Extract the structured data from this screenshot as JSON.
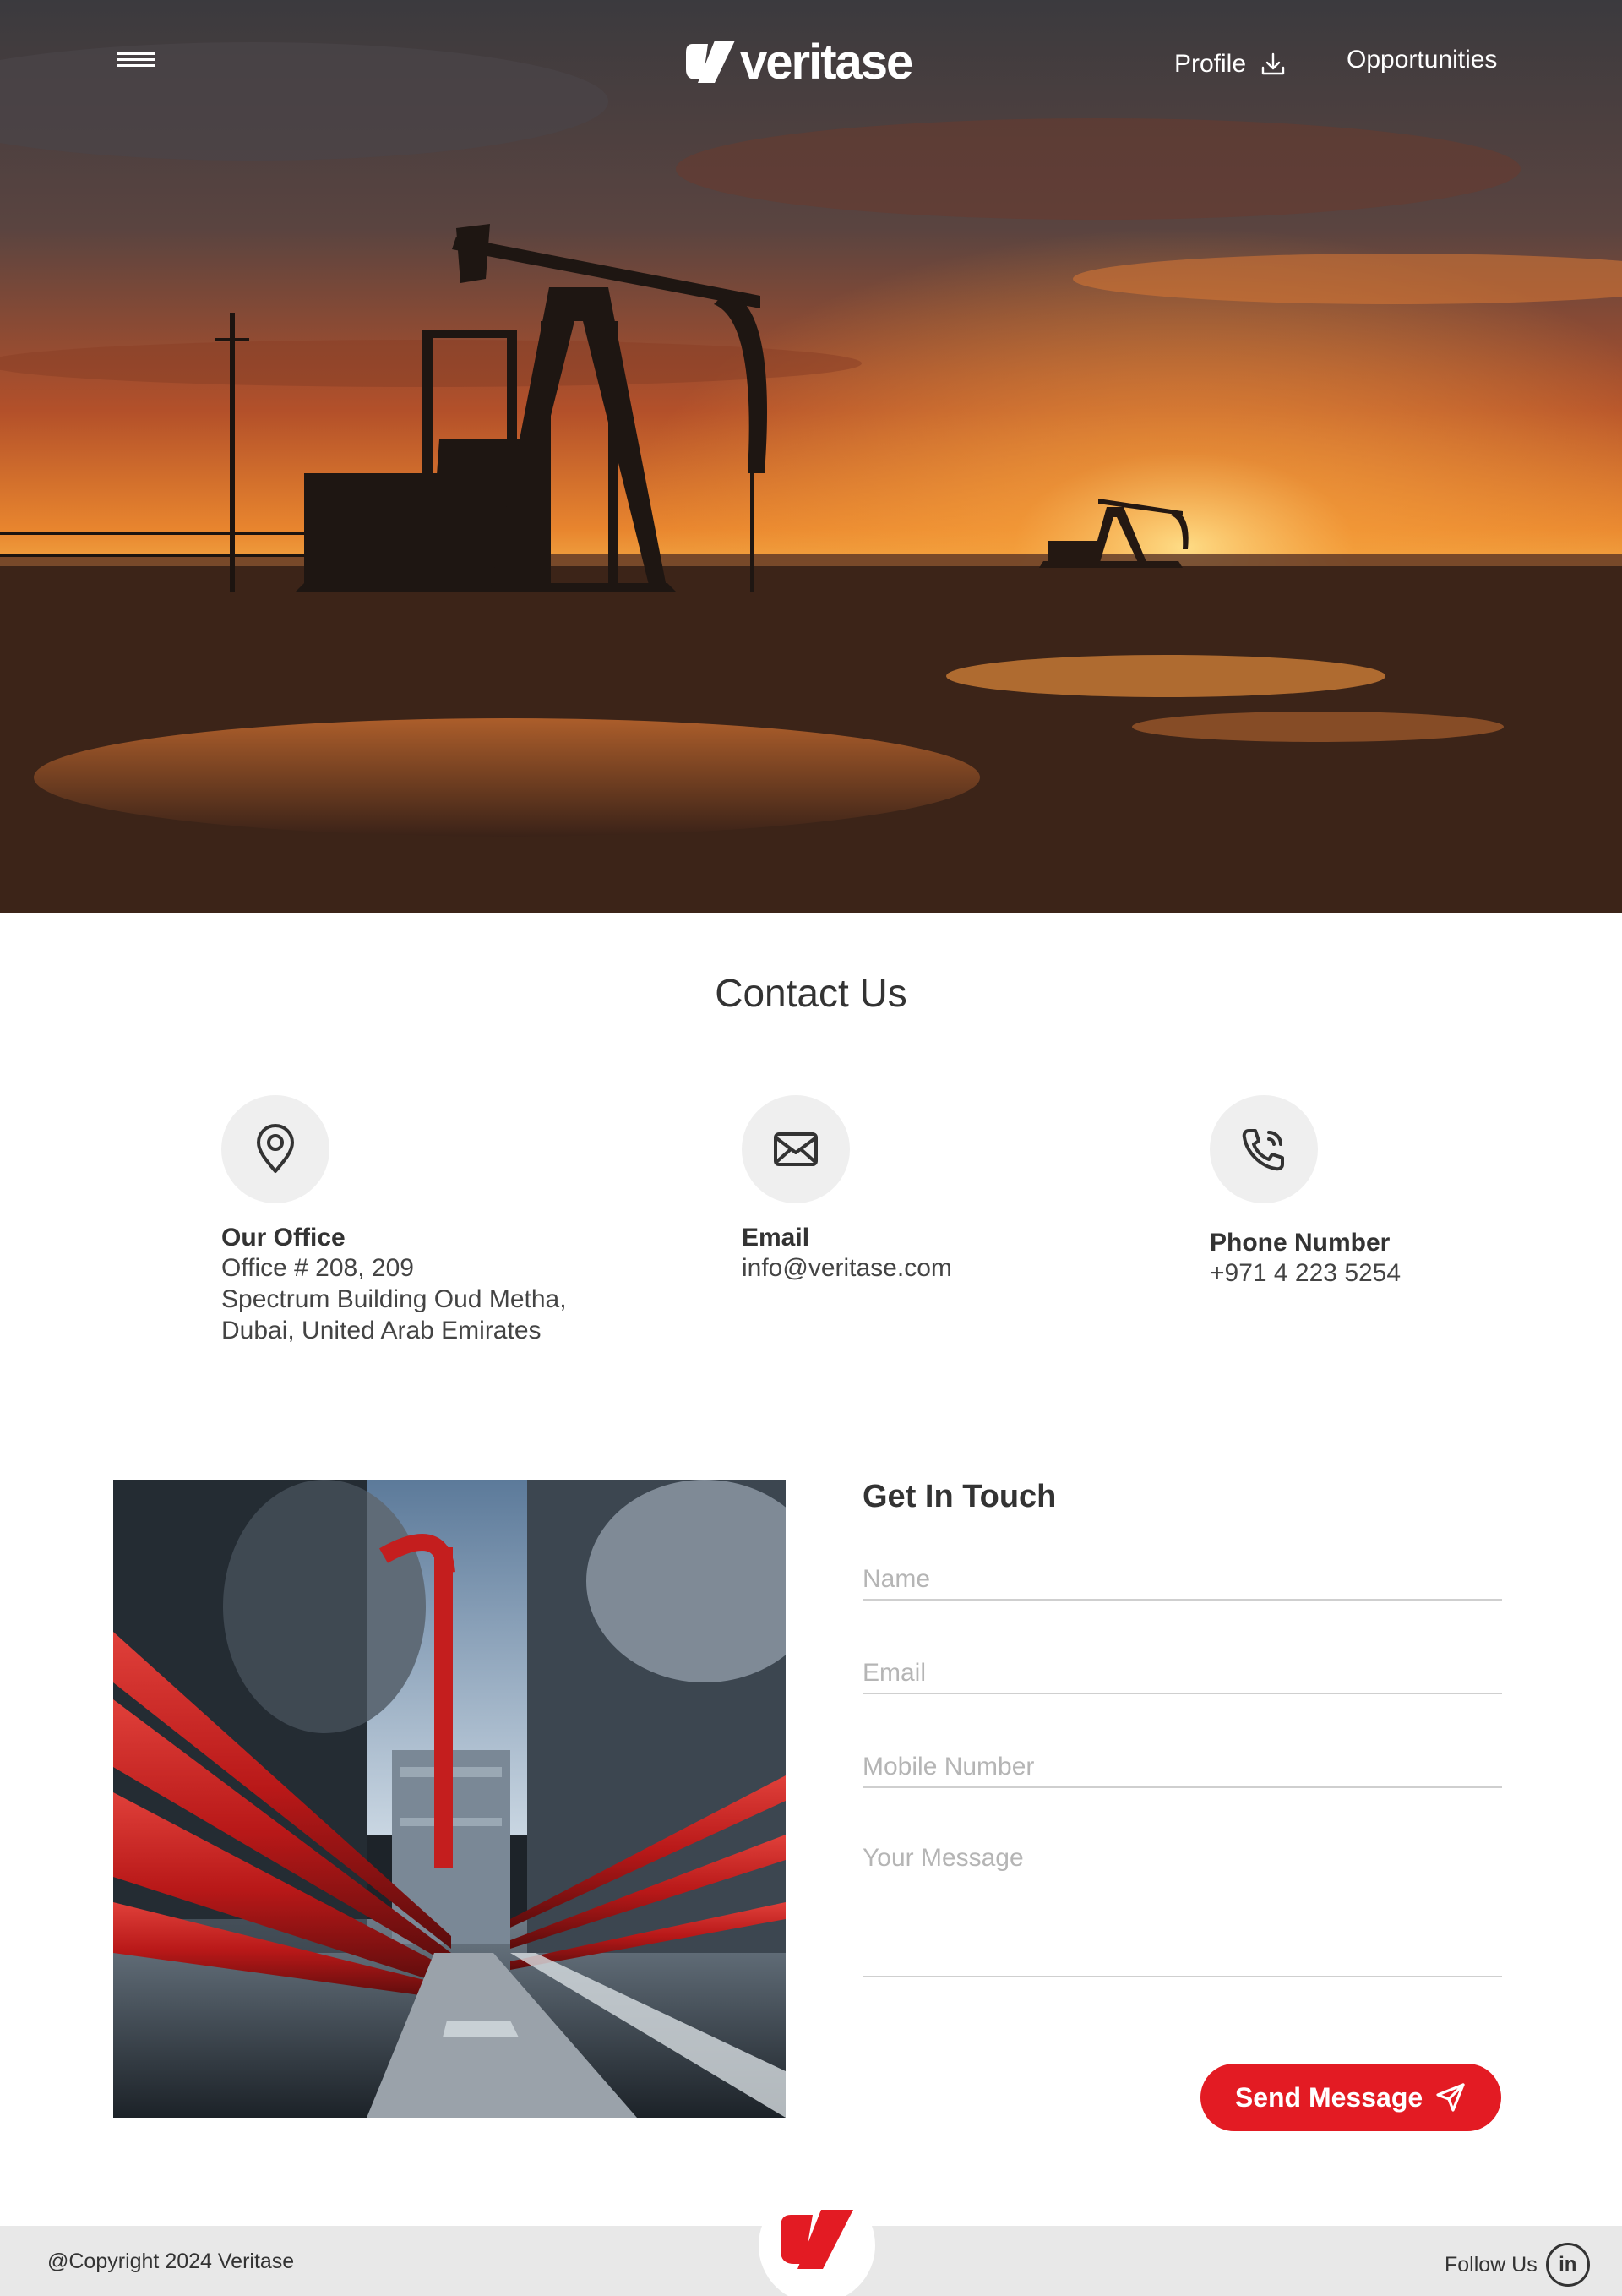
{
  "header": {
    "brand": "veritase",
    "nav": {
      "profile_label": "Profile",
      "profile_icon": "download-icon",
      "opportunities_label": "Opportunities"
    },
    "menu_icon": "hamburger-menu-icon"
  },
  "contact": {
    "title": "Contact Us",
    "office": {
      "icon": "map-pin-icon",
      "label": "Our Office",
      "lines": [
        "Office # 208, 209",
        "Spectrum Building Oud Metha,",
        "Dubai, United Arab Emirates"
      ]
    },
    "email": {
      "icon": "envelope-icon",
      "label": "Email",
      "value": "info@veritase.com"
    },
    "phone": {
      "icon": "phone-ringing-icon",
      "label": "Phone Number",
      "value": "+971 4 223 5254"
    }
  },
  "form": {
    "title": "Get In Touch",
    "name_placeholder": "Name",
    "email_placeholder": "Email",
    "mobile_placeholder": "Mobile Number",
    "message_placeholder": "Your Message",
    "send_label": "Send Message",
    "send_icon": "paper-plane-icon"
  },
  "footer": {
    "copyright": "@Copyright 2024 Veritase",
    "follow_label": "Follow Us",
    "linkedin_text": "in"
  },
  "colors": {
    "accent": "#e31b23",
    "footer_bg": "#e8e8e8",
    "icon_circle_bg": "#efefef"
  }
}
